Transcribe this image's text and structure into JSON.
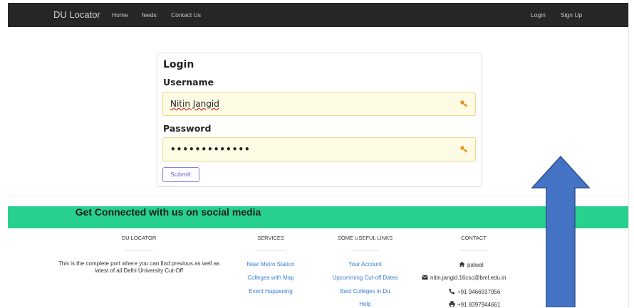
{
  "navbar": {
    "brand": "DU Locator",
    "left_links": [
      "Home",
      "feeds",
      "Contact Us"
    ],
    "right_links": [
      "Login",
      "Sign Up"
    ]
  },
  "login": {
    "title": "Login",
    "username_label": "Username",
    "username_value": "Nitin Jangid",
    "password_label": "Password",
    "password_value": "•••••••••••••",
    "submit_label": "Submit"
  },
  "footer": {
    "social_heading": "Get Connected with us on social media",
    "columns": {
      "about": {
        "title": "DU LOCATOR",
        "text": "This is the complete port where you can find previous as well as latest of all Delhi University Cut-Off"
      },
      "services": {
        "title": "SERVICES",
        "links": [
          "Near Metro Station",
          "Colleges with Map",
          "Event Happening"
        ]
      },
      "useful": {
        "title": "SOME USEFUL LINKS",
        "links": [
          "Your Account",
          "Upcomming Cut-off Dates",
          "Best Colleges in Du",
          "Help"
        ]
      },
      "contact": {
        "title": "CONTACT",
        "address": "palwal",
        "email": "nitin.jangid.16csc@bml.edu.in",
        "phone": "+91 9466937956",
        "fax": "+91 8397944661"
      }
    }
  },
  "colors": {
    "navbar": "#262626",
    "social_bar": "#27d08c",
    "arrow_fill": "#4472c4",
    "arrow_stroke": "#2f528f",
    "field_bg": "#fdfbe4",
    "link": "#3a7fd6"
  },
  "icons": [
    "key-icon",
    "home-icon",
    "envelope-icon",
    "phone-icon",
    "print-icon",
    "arrow-up"
  ]
}
